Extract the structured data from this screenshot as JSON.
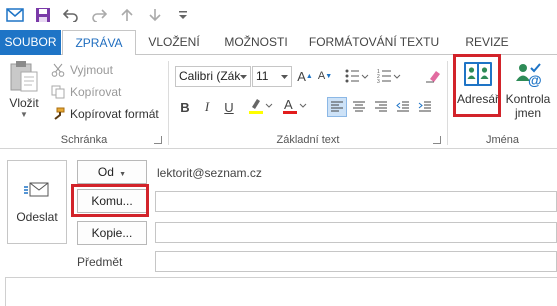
{
  "quick_access": {
    "icons": [
      "envelope-icon",
      "save-icon",
      "undo-icon",
      "redo-icon",
      "up-arrow-icon",
      "down-arrow-icon",
      "customize-icon"
    ]
  },
  "tabs": {
    "file": "SOUBOR",
    "items": [
      "ZPRÁVA",
      "VLOŽENÍ",
      "MOŽNOSTI",
      "FORMÁTOVÁNÍ TEXTU",
      "REVIZE"
    ],
    "active": "ZPRÁVA"
  },
  "clipboard": {
    "paste": "Vložit",
    "cut": "Vyjmout",
    "copy": "Kopírovat",
    "format_painter": "Kopírovat formát",
    "group": "Schránka"
  },
  "basic_text": {
    "font": "Calibri (Zák",
    "size": "11",
    "group": "Základní text"
  },
  "names": {
    "address_book": "Adresář",
    "check_names_line1": "Kontrola",
    "check_names_line2": "jmen",
    "group": "Jména"
  },
  "message": {
    "send": "Odeslat",
    "from_button": "Od",
    "from_value": "lektorit@seznam.cz",
    "to_button": "Komu...",
    "cc_button": "Kopie...",
    "subject_label": "Předmět"
  },
  "colors": {
    "accent": "#1e74c6",
    "highlight_box": "#d2232a",
    "highlighter_yellow": "#ffff00",
    "font_red": "#e21c1c"
  }
}
